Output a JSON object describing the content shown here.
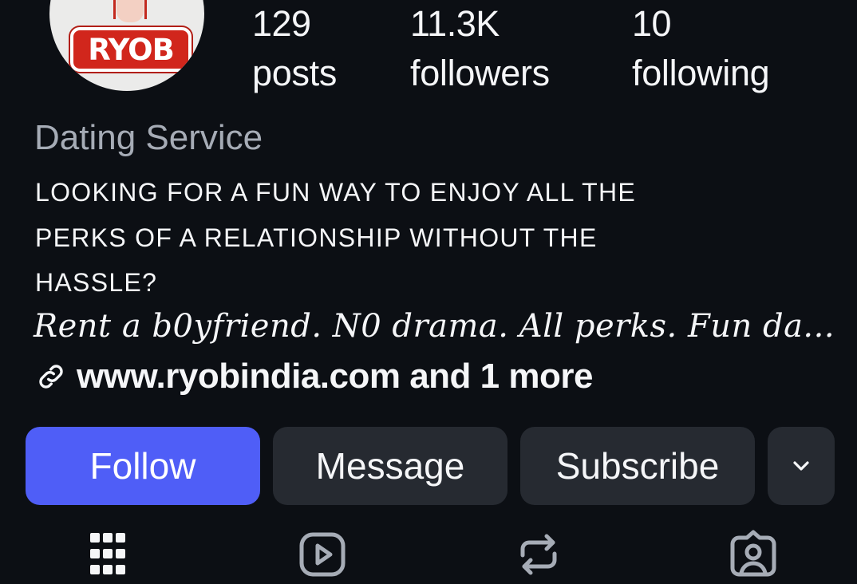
{
  "profile": {
    "avatar_logo": "RYOB",
    "category": "Dating Service",
    "bio_lines": [
      "LOOKING FOR A FUN WAY TO ENJOY ALL THE",
      "PERKS OF A RELATIONSHIP WITHOUT THE",
      "HASSLE?"
    ],
    "script_line": "Rent a b0yfriend. N0 drama. All perks. Fun da...",
    "link_text": "www.ryobindia.com and 1 more",
    "link_icon": "link-icon"
  },
  "stats": {
    "posts": {
      "count": "129",
      "label": "posts"
    },
    "followers": {
      "count": "11.3K",
      "label": "followers"
    },
    "following": {
      "count": "10",
      "label": "following"
    }
  },
  "actions": {
    "follow": "Follow",
    "message": "Message",
    "subscribe": "Subscribe",
    "more_icon": "chevron-down-icon"
  },
  "tabs": [
    {
      "icon": "grid-icon"
    },
    {
      "icon": "reels-icon"
    },
    {
      "icon": "repost-icon"
    },
    {
      "icon": "tagged-icon"
    }
  ],
  "colors": {
    "background": "#0c0f14",
    "text": "#f5f6f8",
    "muted_text": "#a6acb6",
    "follow_button": "#4f5ef7",
    "secondary_button": "#262a31",
    "logo_red": "#d1261c"
  }
}
